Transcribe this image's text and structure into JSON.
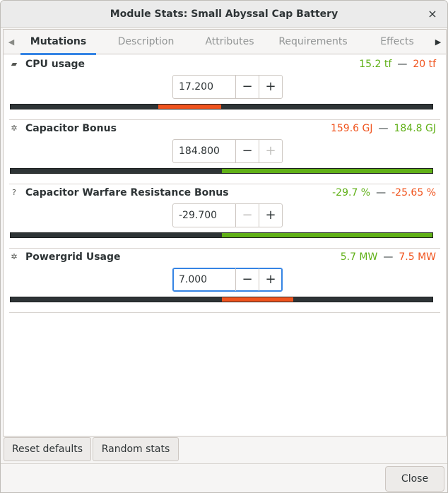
{
  "window": {
    "title": "Module Stats: Small Abyssal Cap Battery"
  },
  "tabs": [
    {
      "label": "Mutations",
      "active": true
    },
    {
      "label": "Description",
      "active": false
    },
    {
      "label": "Attributes",
      "active": false
    },
    {
      "label": "Requirements",
      "active": false
    },
    {
      "label": "Effects",
      "active": false
    }
  ],
  "mutations": [
    {
      "name": "CPU usage",
      "icon": "cpu-icon",
      "min": "15.2 tf",
      "max": "20 tf",
      "min_color": "#60b017",
      "max_color": "#f0541e",
      "value": "17.200",
      "fraction": 0.35,
      "fill_color": "#f0541e",
      "minus_enabled": true,
      "plus_enabled": true
    },
    {
      "name": "Capacitor Bonus",
      "icon": "capacitor-icon",
      "min": "159.6 GJ",
      "max": "184.8 GJ",
      "min_color": "#f0541e",
      "max_color": "#60b017",
      "value": "184.800",
      "fraction": 1.0,
      "fill_color": "#60b017",
      "minus_enabled": true,
      "plus_enabled": false
    },
    {
      "name": "Capacitor Warfare Resistance Bonus",
      "icon": "unknown-attribute-icon",
      "min": "-29.7 %",
      "max": "-25.65 %",
      "min_color": "#60b017",
      "max_color": "#f0541e",
      "value": "-29.700",
      "fraction": 1.0,
      "fill_color": "#60b017",
      "minus_enabled": false,
      "plus_enabled": true
    },
    {
      "name": "Powergrid Usage",
      "icon": "powergrid-icon",
      "min": "5.7 MW",
      "max": "7.5 MW",
      "min_color": "#60b017",
      "max_color": "#f0541e",
      "value": "7.000",
      "fraction": 0.67,
      "fill_color": "#f0541e",
      "minus_enabled": true,
      "plus_enabled": true,
      "focused": true
    }
  ],
  "buttons": {
    "reset": "Reset defaults",
    "random": "Random stats",
    "close": "Close"
  },
  "symbols": {
    "minus": "−",
    "plus": "+",
    "dash": "—",
    "close": "×",
    "arrow_left": "◀",
    "arrow_right": "▶"
  }
}
